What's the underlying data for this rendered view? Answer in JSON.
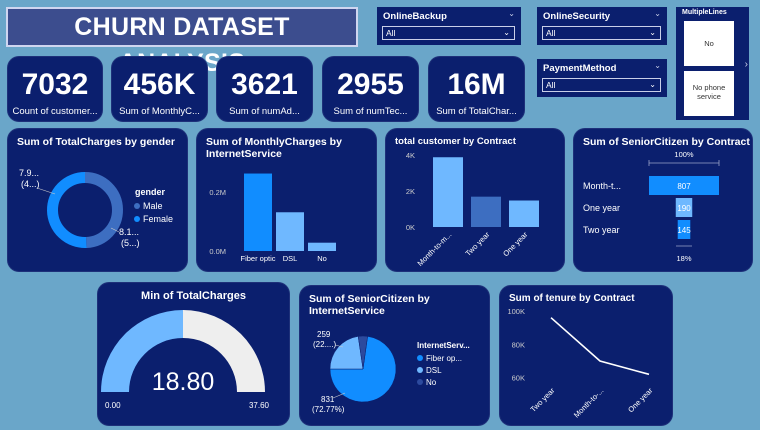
{
  "header": {
    "title": "CHURN DATASET ANALYSIS"
  },
  "slicers": {
    "online_backup": {
      "label": "OnlineBackup",
      "value": "All"
    },
    "online_security": {
      "label": "OnlineSecurity",
      "value": "All"
    },
    "payment_method": {
      "label": "PaymentMethod",
      "value": "All"
    },
    "multiple_lines": {
      "label": "MultipleLines",
      "options": [
        "No",
        "No phone service"
      ]
    }
  },
  "kpis": [
    {
      "value": "7032",
      "label": "Count of customer..."
    },
    {
      "value": "456K",
      "label": "Sum of MonthlyC..."
    },
    {
      "value": "3621",
      "label": "Sum of numAd..."
    },
    {
      "value": "2955",
      "label": "Sum of numTec..."
    },
    {
      "value": "16M",
      "label": "Sum of TotalChar..."
    }
  ],
  "colors": {
    "primary": "#118dff",
    "light": "#6fb8ff",
    "mid": "#3d6ec1",
    "dark": "#2c4a9e",
    "card": "#0b1f6e"
  },
  "chart_data": [
    {
      "id": "totalcharges_gender",
      "type": "pie",
      "title": "Sum of TotalCharges by gender",
      "legend_title": "gender",
      "legend_position": "right",
      "slices": [
        {
          "name": "Male",
          "value": 7.9
        },
        {
          "name": "Female",
          "value": 8.1
        }
      ],
      "labels": [
        {
          "line1": "7.9...",
          "line2": "(4...)"
        },
        {
          "line1": "8.1...",
          "line2": "(5...)"
        }
      ]
    },
    {
      "id": "monthly_internet",
      "type": "bar",
      "title": "Sum of MonthlyCharges by InternetService",
      "categories": [
        "Fiber optic",
        "DSL",
        "No"
      ],
      "values": [
        0.28,
        0.14,
        0.03
      ],
      "yticks": [
        "0.2M",
        "0.0M"
      ],
      "ylim": [
        0,
        0.3
      ]
    },
    {
      "id": "customer_contract",
      "type": "bar",
      "title": "total customer by Contract",
      "categories": [
        "Month-to-m...",
        "Two year",
        "One year"
      ],
      "values": [
        3875,
        1685,
        1472
      ],
      "yticks": [
        "4K",
        "2K",
        "0K"
      ],
      "ylim": [
        0,
        4000
      ]
    },
    {
      "id": "senior_contract",
      "type": "bar",
      "title": "Sum of SeniorCitizen by Contract",
      "orientation": "funnel",
      "categories": [
        "Month-t...",
        "One year",
        "Two year"
      ],
      "values": [
        807,
        190,
        145
      ],
      "top_label": "100%",
      "bottom_label": "18%"
    },
    {
      "id": "min_totalcharges",
      "type": "gauge",
      "title": "Min of TotalCharges",
      "value": 18.8,
      "value_label": "18.80",
      "min_label": "0.00",
      "max_label": "37.60",
      "min": 0,
      "max": 37.6
    },
    {
      "id": "senior_internet",
      "type": "pie",
      "title": "Sum of SeniorCitizen by InternetService",
      "legend_title": "InternetServ...",
      "legend_position": "right",
      "slices": [
        {
          "name": "Fiber op...",
          "value": 831
        },
        {
          "name": "DSL",
          "value": 259
        },
        {
          "name": "No",
          "value": 52
        }
      ],
      "labels": [
        {
          "line1": "831",
          "line2": "(72.77%)"
        },
        {
          "line1": "259",
          "line2": "(22....)"
        }
      ]
    },
    {
      "id": "tenure_contract",
      "type": "line",
      "title": "Sum of tenure by Contract",
      "categories": [
        "Two year",
        "Month-to-...",
        "One year"
      ],
      "values": [
        96000,
        70000,
        62000
      ],
      "yticks": [
        "100K",
        "80K",
        "60K"
      ],
      "ylim": [
        58000,
        100000
      ]
    }
  ]
}
